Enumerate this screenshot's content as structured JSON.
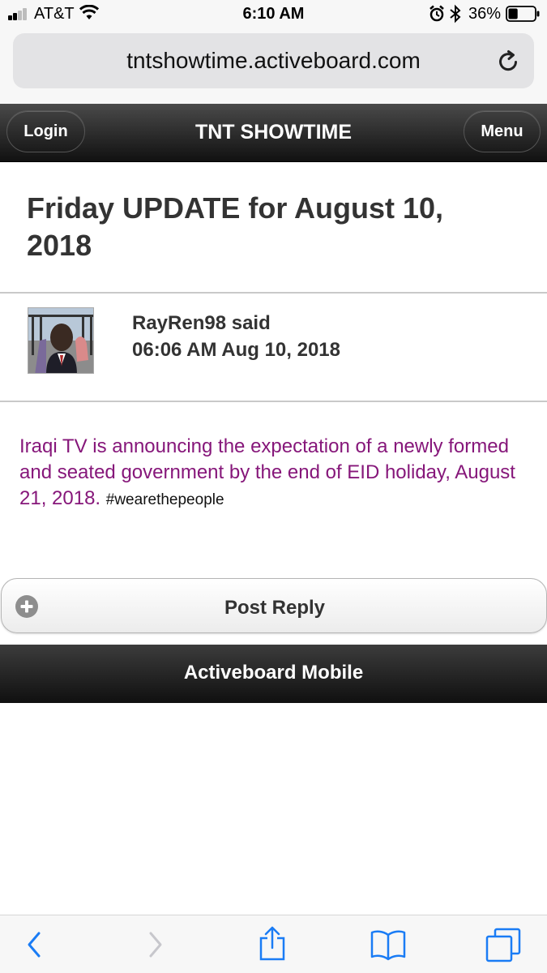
{
  "status_bar": {
    "carrier": "AT&T",
    "time": "6:10 AM",
    "battery_percent": "36%",
    "battery_level": 0.36
  },
  "browser": {
    "url": "tntshowtime.activeboard.com"
  },
  "header": {
    "login_label": "Login",
    "site_title": "TNT SHOWTIME",
    "menu_label": "Menu"
  },
  "thread": {
    "title": "Friday UPDATE for August 10, 2018"
  },
  "post": {
    "author_line": "RayRen98 said",
    "date": "06:06 AM Aug 10, 2018",
    "body": "Iraqi TV is announcing the expectation of a newly formed and seated government by the end of EID holiday, August 21, 2018.",
    "hashtag": "#wearethepeople"
  },
  "actions": {
    "post_reply_label": "Post Reply"
  },
  "footer": {
    "label": "Activeboard Mobile"
  },
  "colors": {
    "post_text": "#86177a",
    "ios_blue": "#1a7cf5",
    "header_dark": "#1a1a1a"
  },
  "icons": {
    "back": "chevron-left-icon",
    "forward": "chevron-right-icon",
    "share": "share-icon",
    "bookmarks": "book-icon",
    "tabs": "tabs-icon",
    "reload": "reload-icon",
    "reply": "plus-circle-icon"
  }
}
